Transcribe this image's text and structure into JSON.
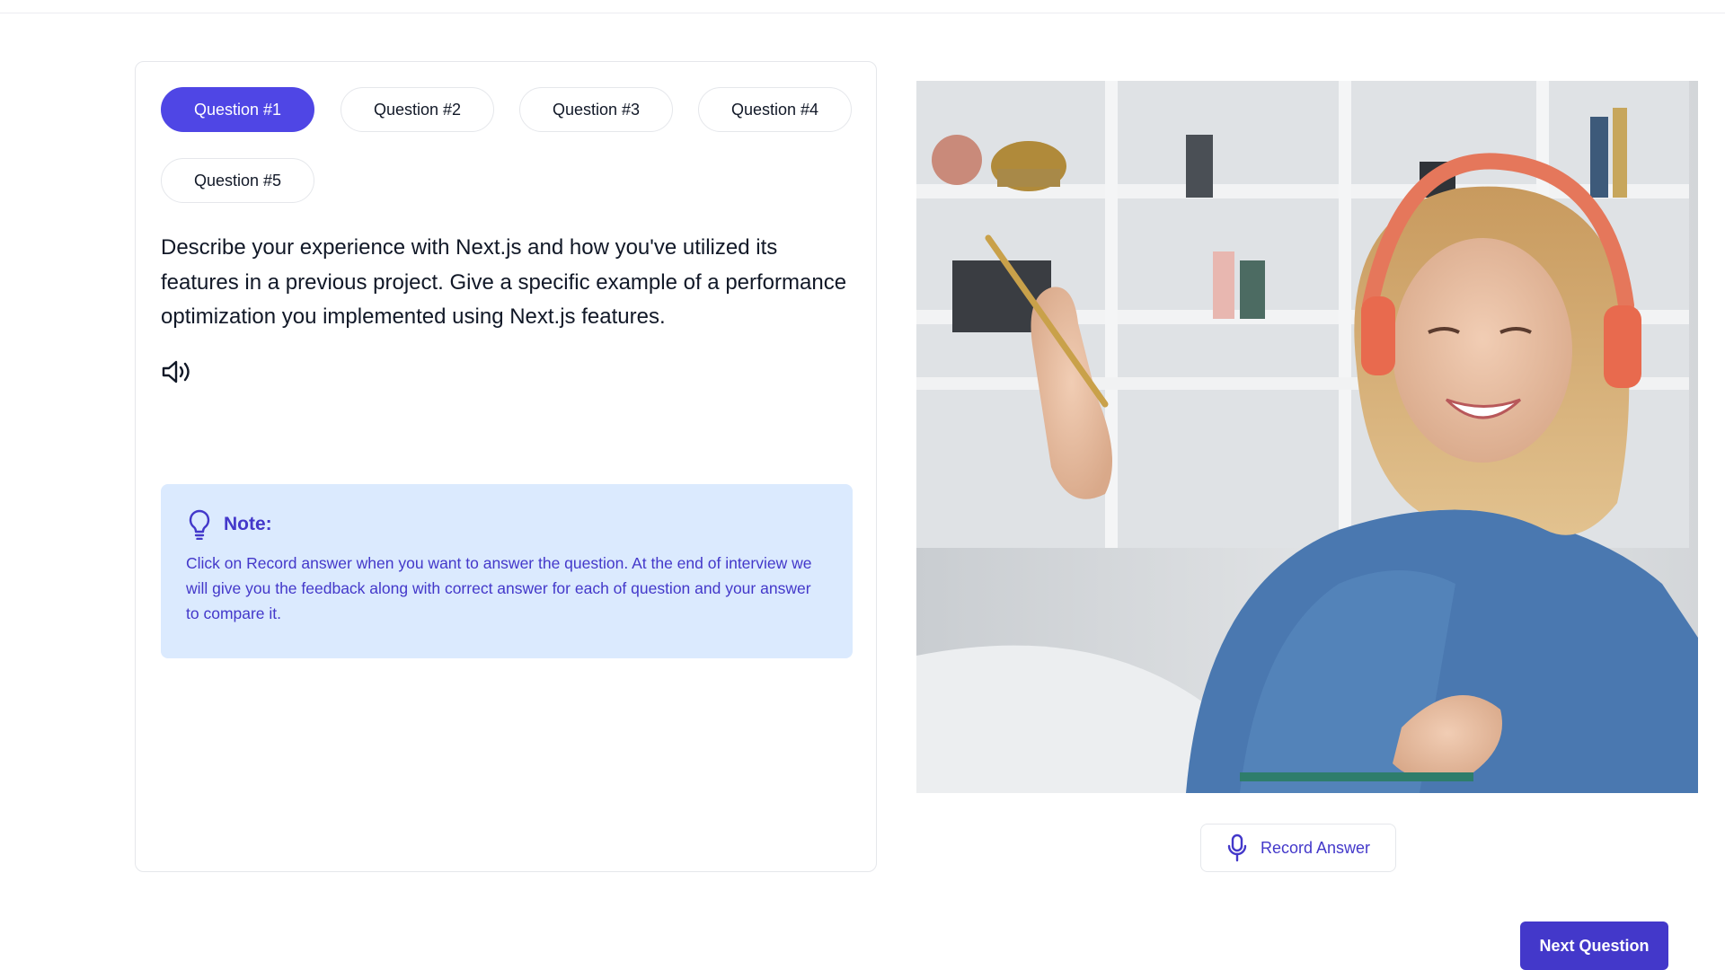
{
  "tabs": [
    {
      "label": "Question #1",
      "active": true
    },
    {
      "label": "Question #2",
      "active": false
    },
    {
      "label": "Question #3",
      "active": false
    },
    {
      "label": "Question #4",
      "active": false
    },
    {
      "label": "Question #5",
      "active": false
    }
  ],
  "question": {
    "text": "Describe your experience with Next.js and how you've utilized its features in a previous project. Give a specific example of a performance optimization you implemented using Next.js features.",
    "speaker_icon": "speaker-icon"
  },
  "note": {
    "icon": "lightbulb-icon",
    "title": "Note:",
    "body": "Click on Record answer when you want to answer the question. At the end of interview we will give you the feedback along with correct answer for each of question and your answer to compare it."
  },
  "record": {
    "icon": "microphone-icon",
    "label": "Record Answer"
  },
  "next": {
    "label": "Next Question"
  },
  "colors": {
    "accent": "#4f46e5",
    "accent_dark": "#4338ca",
    "note_bg": "#dbeafe"
  }
}
